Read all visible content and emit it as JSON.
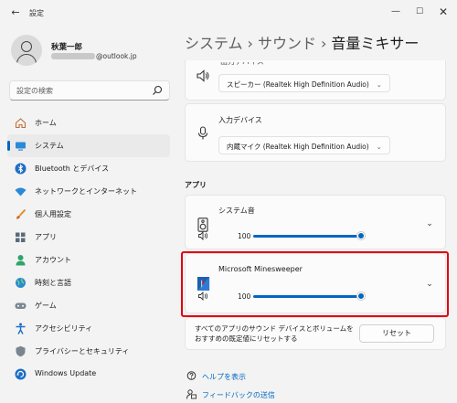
{
  "window": {
    "back_glyph": "←",
    "title": "設定",
    "minimize_glyph": "—",
    "maximize_glyph": "☐",
    "close_glyph": "✕"
  },
  "profile": {
    "name": "秋葉一郎",
    "email_visible": "@outlook.jp"
  },
  "search": {
    "placeholder": "設定の検索"
  },
  "sidebar": {
    "items": [
      {
        "label": "ホーム",
        "icon": "home-icon"
      },
      {
        "label": "システム",
        "icon": "system-icon",
        "active": true
      },
      {
        "label": "Bluetooth とデバイス",
        "icon": "bluetooth-icon"
      },
      {
        "label": "ネットワークとインターネット",
        "icon": "wifi-icon"
      },
      {
        "label": "個人用設定",
        "icon": "brush-icon"
      },
      {
        "label": "アプリ",
        "icon": "apps-icon"
      },
      {
        "label": "アカウント",
        "icon": "account-icon"
      },
      {
        "label": "時刻と言語",
        "icon": "globe-icon"
      },
      {
        "label": "ゲーム",
        "icon": "gamepad-icon"
      },
      {
        "label": "アクセシビリティ",
        "icon": "accessibility-icon"
      },
      {
        "label": "プライバシーとセキュリティ",
        "icon": "shield-icon"
      },
      {
        "label": "Windows Update",
        "icon": "update-icon"
      }
    ]
  },
  "header": {
    "crumb1": "システム",
    "crumb2": "サウンド",
    "current": "音量ミキサー",
    "separator": "›"
  },
  "output": {
    "label_clipped": "出力デバイス",
    "device": "スピーカー (Realtek High Definition Audio)"
  },
  "input": {
    "label": "入力デバイス",
    "device": "内蔵マイク (Realtek High Definition Audio)"
  },
  "apps_section": {
    "label": "アプリ"
  },
  "apps": [
    {
      "name": "システム音",
      "volume": 100,
      "icon": "speaker-icon"
    },
    {
      "name": "Microsoft Minesweeper",
      "volume": 100,
      "icon": "minesweeper-icon"
    }
  ],
  "reset": {
    "description": "すべてのアプリのサウンド デバイスとボリュームをおすすめの既定値にリセットする",
    "button": "リセット"
  },
  "links": {
    "help": "ヘルプを表示",
    "feedback": "フィードバックの送信"
  },
  "colors": {
    "accent": "#0067c0",
    "highlight": "#e00010",
    "background": "#f3f3f3"
  }
}
